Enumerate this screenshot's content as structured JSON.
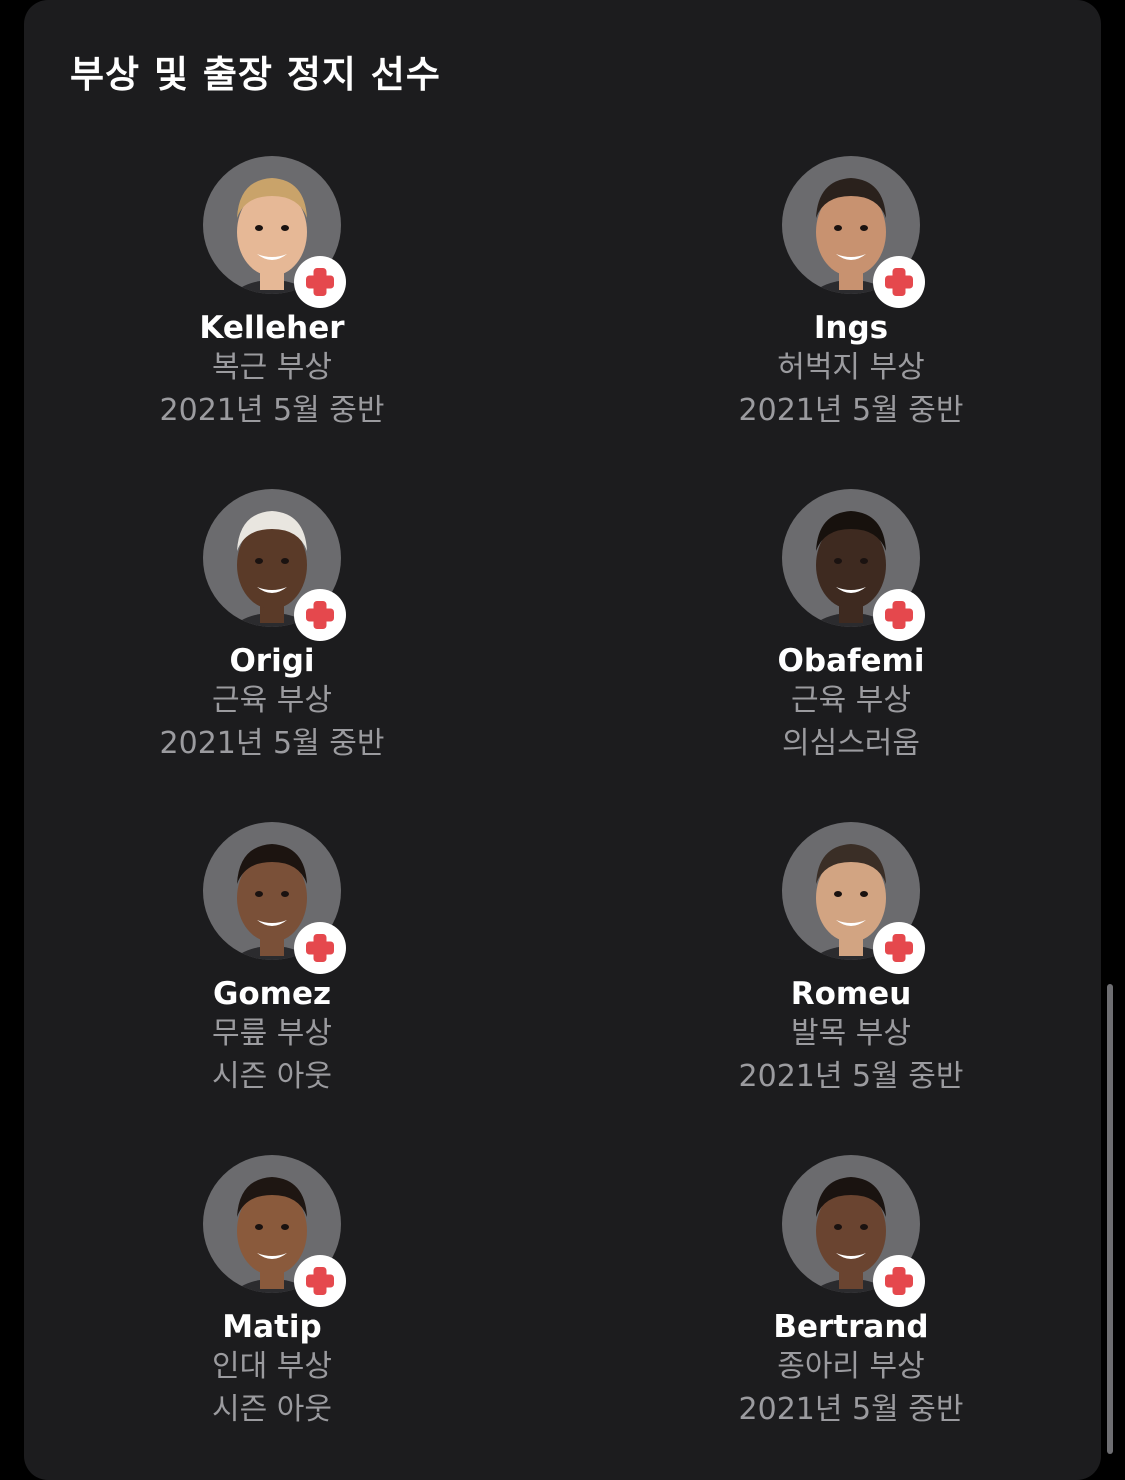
{
  "section": {
    "title": "부상 및 출장 정지 선수"
  },
  "players": [
    {
      "name": "Kelleher",
      "injury": "복근 부상",
      "return": "2021년 5월 중반",
      "skin": "#e6b896",
      "hair": "#c9a36a"
    },
    {
      "name": "Ings",
      "injury": "허벅지 부상",
      "return": "2021년 5월 중반",
      "skin": "#c89270",
      "hair": "#2a211c"
    },
    {
      "name": "Origi",
      "injury": "근육 부상",
      "return": "2021년 5월 중반",
      "skin": "#5a3a28",
      "hair": "#e9e6e0"
    },
    {
      "name": "Obafemi",
      "injury": "근육 부상",
      "return": "의심스러움",
      "skin": "#3e2a20",
      "hair": "#17110d"
    },
    {
      "name": "Gomez",
      "injury": "무릎 부상",
      "return": "시즌 아웃",
      "skin": "#7a5038",
      "hair": "#1c1410"
    },
    {
      "name": "Romeu",
      "injury": "발목 부상",
      "return": "2021년 5월 중반",
      "skin": "#d2a482",
      "hair": "#3a2e26"
    },
    {
      "name": "Matip",
      "injury": "인대 부상",
      "return": "시즌 아웃",
      "skin": "#8a5a3c",
      "hair": "#1e1612"
    },
    {
      "name": "Bertrand",
      "injury": "종아리 부상",
      "return": "2021년 5월 중반",
      "skin": "#6a4430",
      "hair": "#1a1310"
    }
  ],
  "colors": {
    "background": "#000000",
    "card": "#1c1c1e",
    "avatar_bg": "#6b6b6e",
    "badge_cross": "#e5484d"
  }
}
